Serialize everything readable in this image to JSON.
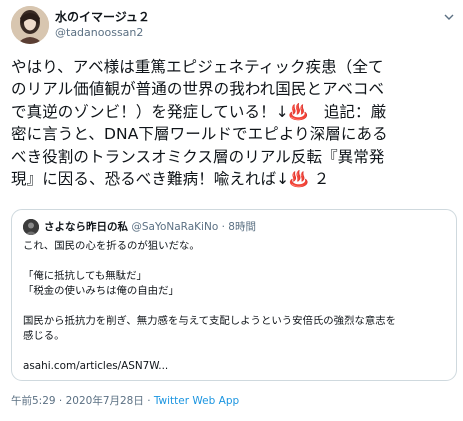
{
  "author": {
    "name": "水のイマージュ２",
    "handle": "@tadanoossan2"
  },
  "tweet": {
    "lines": [
      "やはり、アベ様は重篤エピジェネティック疾患（全て",
      "のリアル価値観が普通の世界の我われ国民とアベコベ",
      "で真逆のゾンビ！）を発症している！↓♨️　追記：厳",
      "密に言うと、DNA下層ワールドでエピより深層にある",
      "べき役割のトランスオミクス層のリアル反転『異常発",
      "現』に因る、恐るべき難病！喩えれば↓♨️ ２"
    ]
  },
  "quote": {
    "name": "さよなら昨日の私",
    "handle": "@SaYoNaRaKiNo",
    "time": "· 8時間",
    "lines": [
      "これ、国民の心を折るのが狙いだな。",
      "",
      "「俺に抵抗しても無駄だ」",
      "「税金の使いみちは俺の自由だ」",
      "",
      "国民から抵抗力を削ぎ、無力感を与えて支配しようという安倍氏の強烈な意志を",
      "感じる。",
      "",
      "asahi.com/articles/ASN7W..."
    ]
  },
  "footer": {
    "timestamp": "午前5:29 · 2020年7月28日 · ",
    "app": "Twitter Web App"
  }
}
